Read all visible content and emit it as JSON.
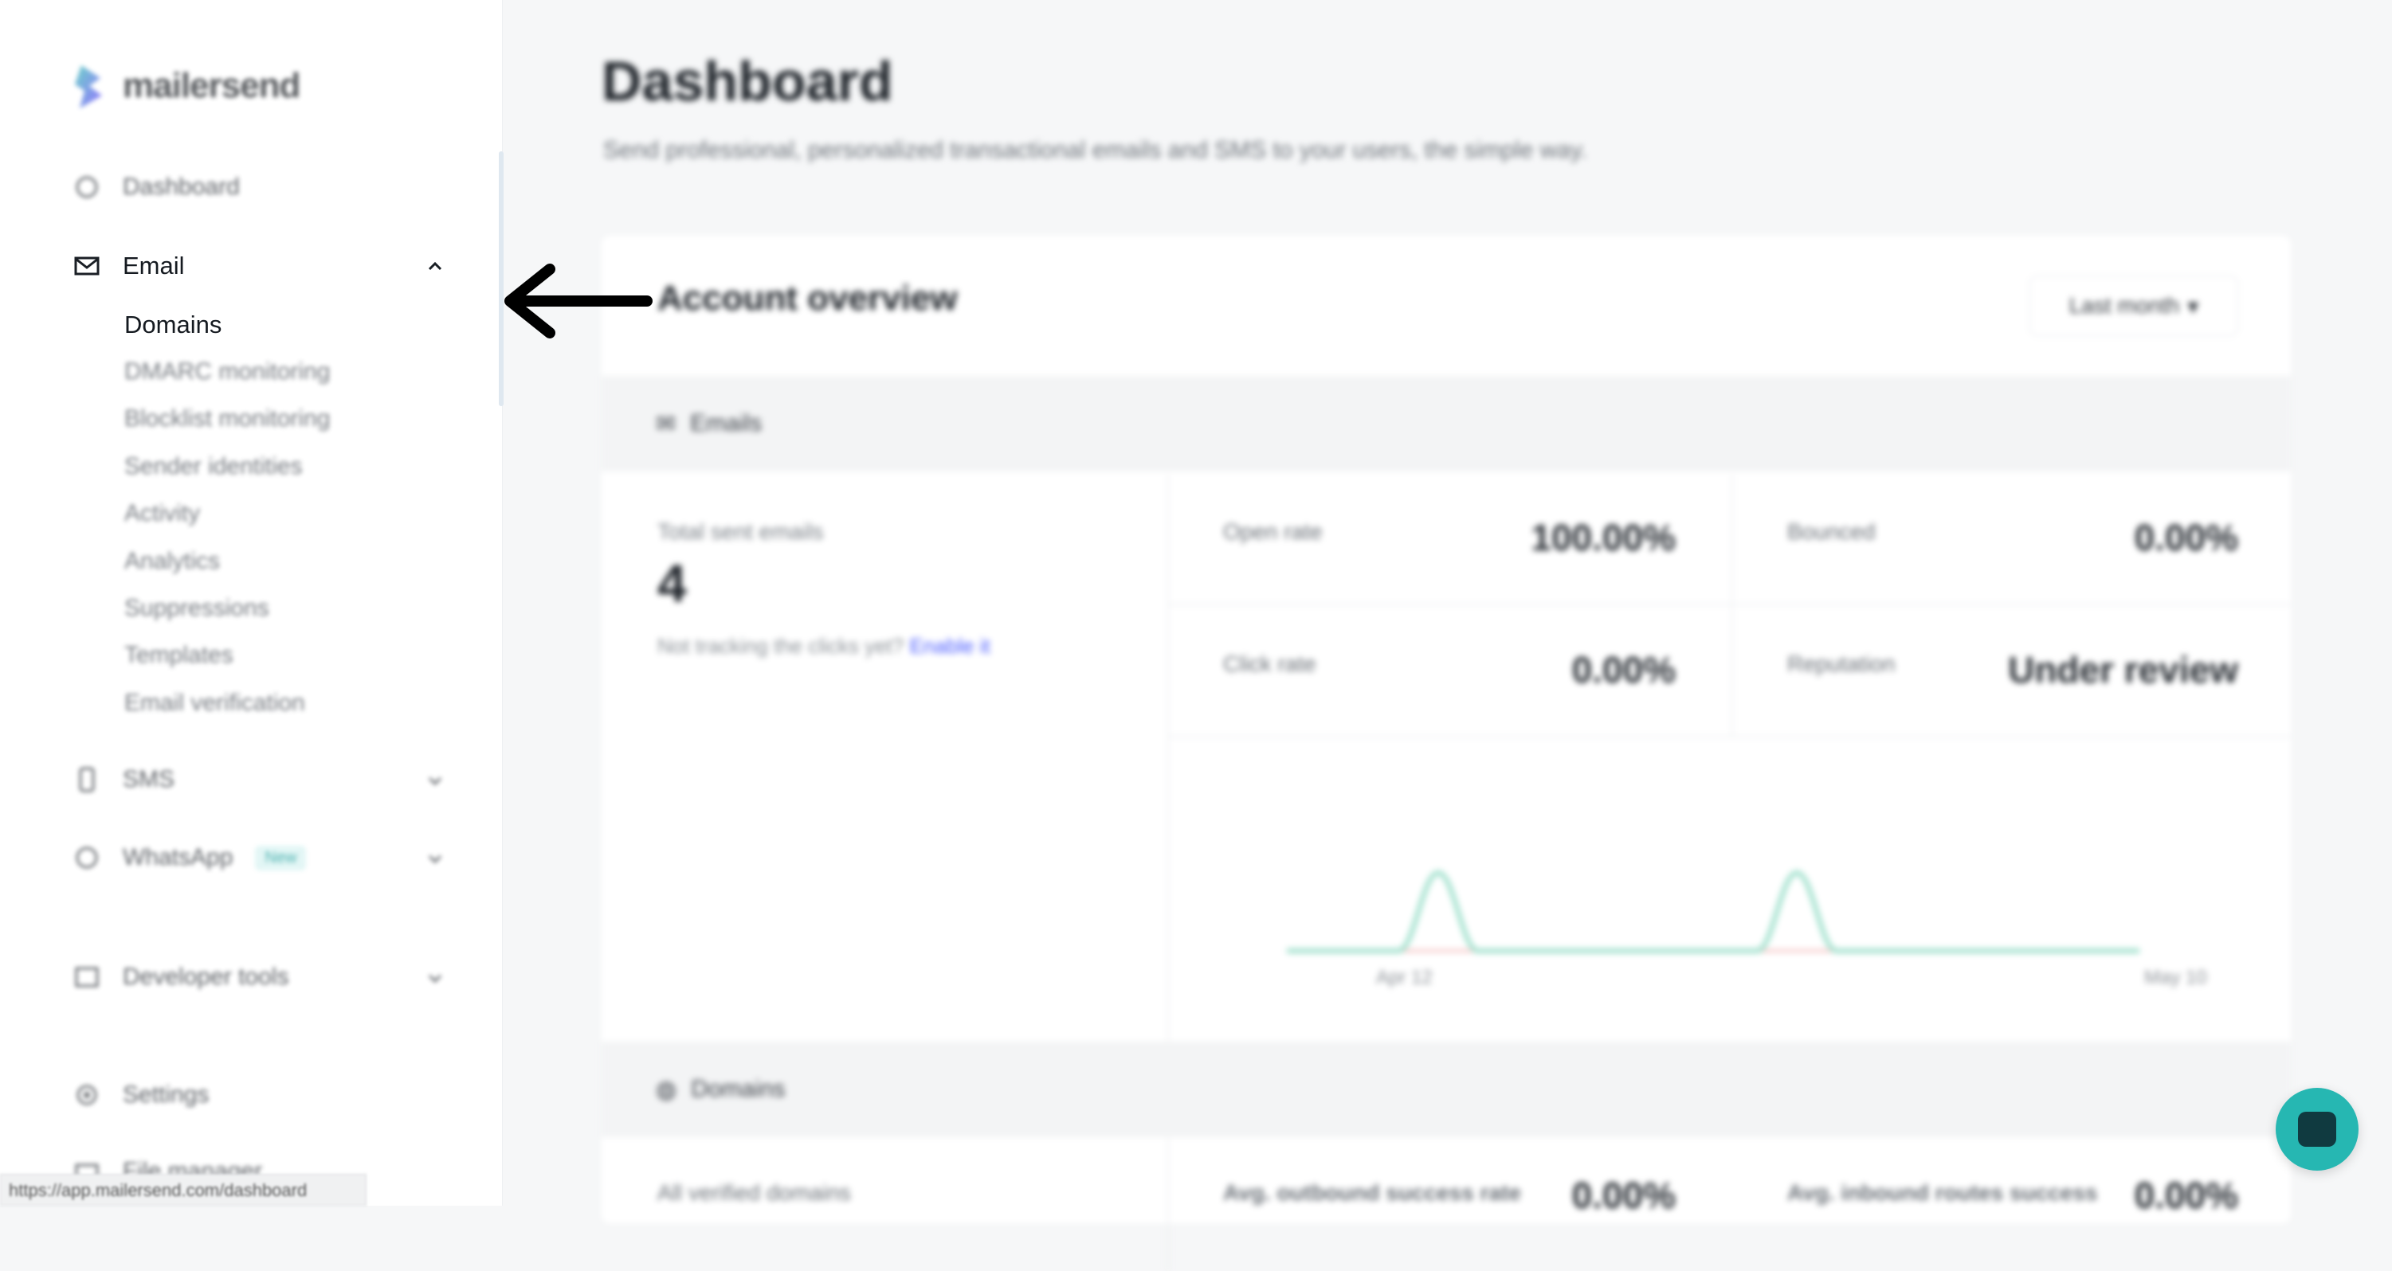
{
  "brand": {
    "name": "mailersend"
  },
  "sidebar": {
    "dashboard": "Dashboard",
    "email": {
      "label": "Email",
      "items": [
        "Domains",
        "DMARC monitoring",
        "Blocklist monitoring",
        "Sender identities",
        "Activity",
        "Analytics",
        "Suppressions",
        "Templates",
        "Email verification"
      ]
    },
    "sms": "SMS",
    "whatsapp": {
      "label": "WhatsApp",
      "badge": "New"
    },
    "developer_tools": "Developer tools",
    "settings": "Settings",
    "next_item": "File manager"
  },
  "status_bar": {
    "url": "https://app.mailersend.com/dashboard"
  },
  "main": {
    "title": "Dashboard",
    "subtitle": "Send professional, personalized transactional emails and SMS to your users, the simple way.",
    "overview": {
      "heading": "Account overview",
      "range": "Last month",
      "emails_section": "Emails",
      "total_label": "Total sent emails",
      "total_value": "4",
      "not_tracking": "Not tracking the clicks yet?",
      "enable_link": "Enable it",
      "open_rate_label": "Open rate",
      "open_rate_value": "100.00%",
      "bounced_label": "Bounced",
      "bounced_value": "0.00%",
      "click_rate_label": "Click rate",
      "click_rate_value": "0.00%",
      "reputation_label": "Reputation",
      "reputation_value": "Under review",
      "chart_start": "Apr 12",
      "chart_end": "May 10",
      "domains_section": "Domains",
      "verified_label": "All verified domains",
      "outbound_label": "Avg. outbound success rate",
      "outbound_value": "0.00%",
      "inbound_label": "Avg. inbound routes success",
      "inbound_value": "0.00%"
    }
  },
  "colors": {
    "accent": "#26b7b2",
    "link": "#4b5cff",
    "chart_line": "#9fe0cc",
    "baseline": "#f3b8b8"
  }
}
